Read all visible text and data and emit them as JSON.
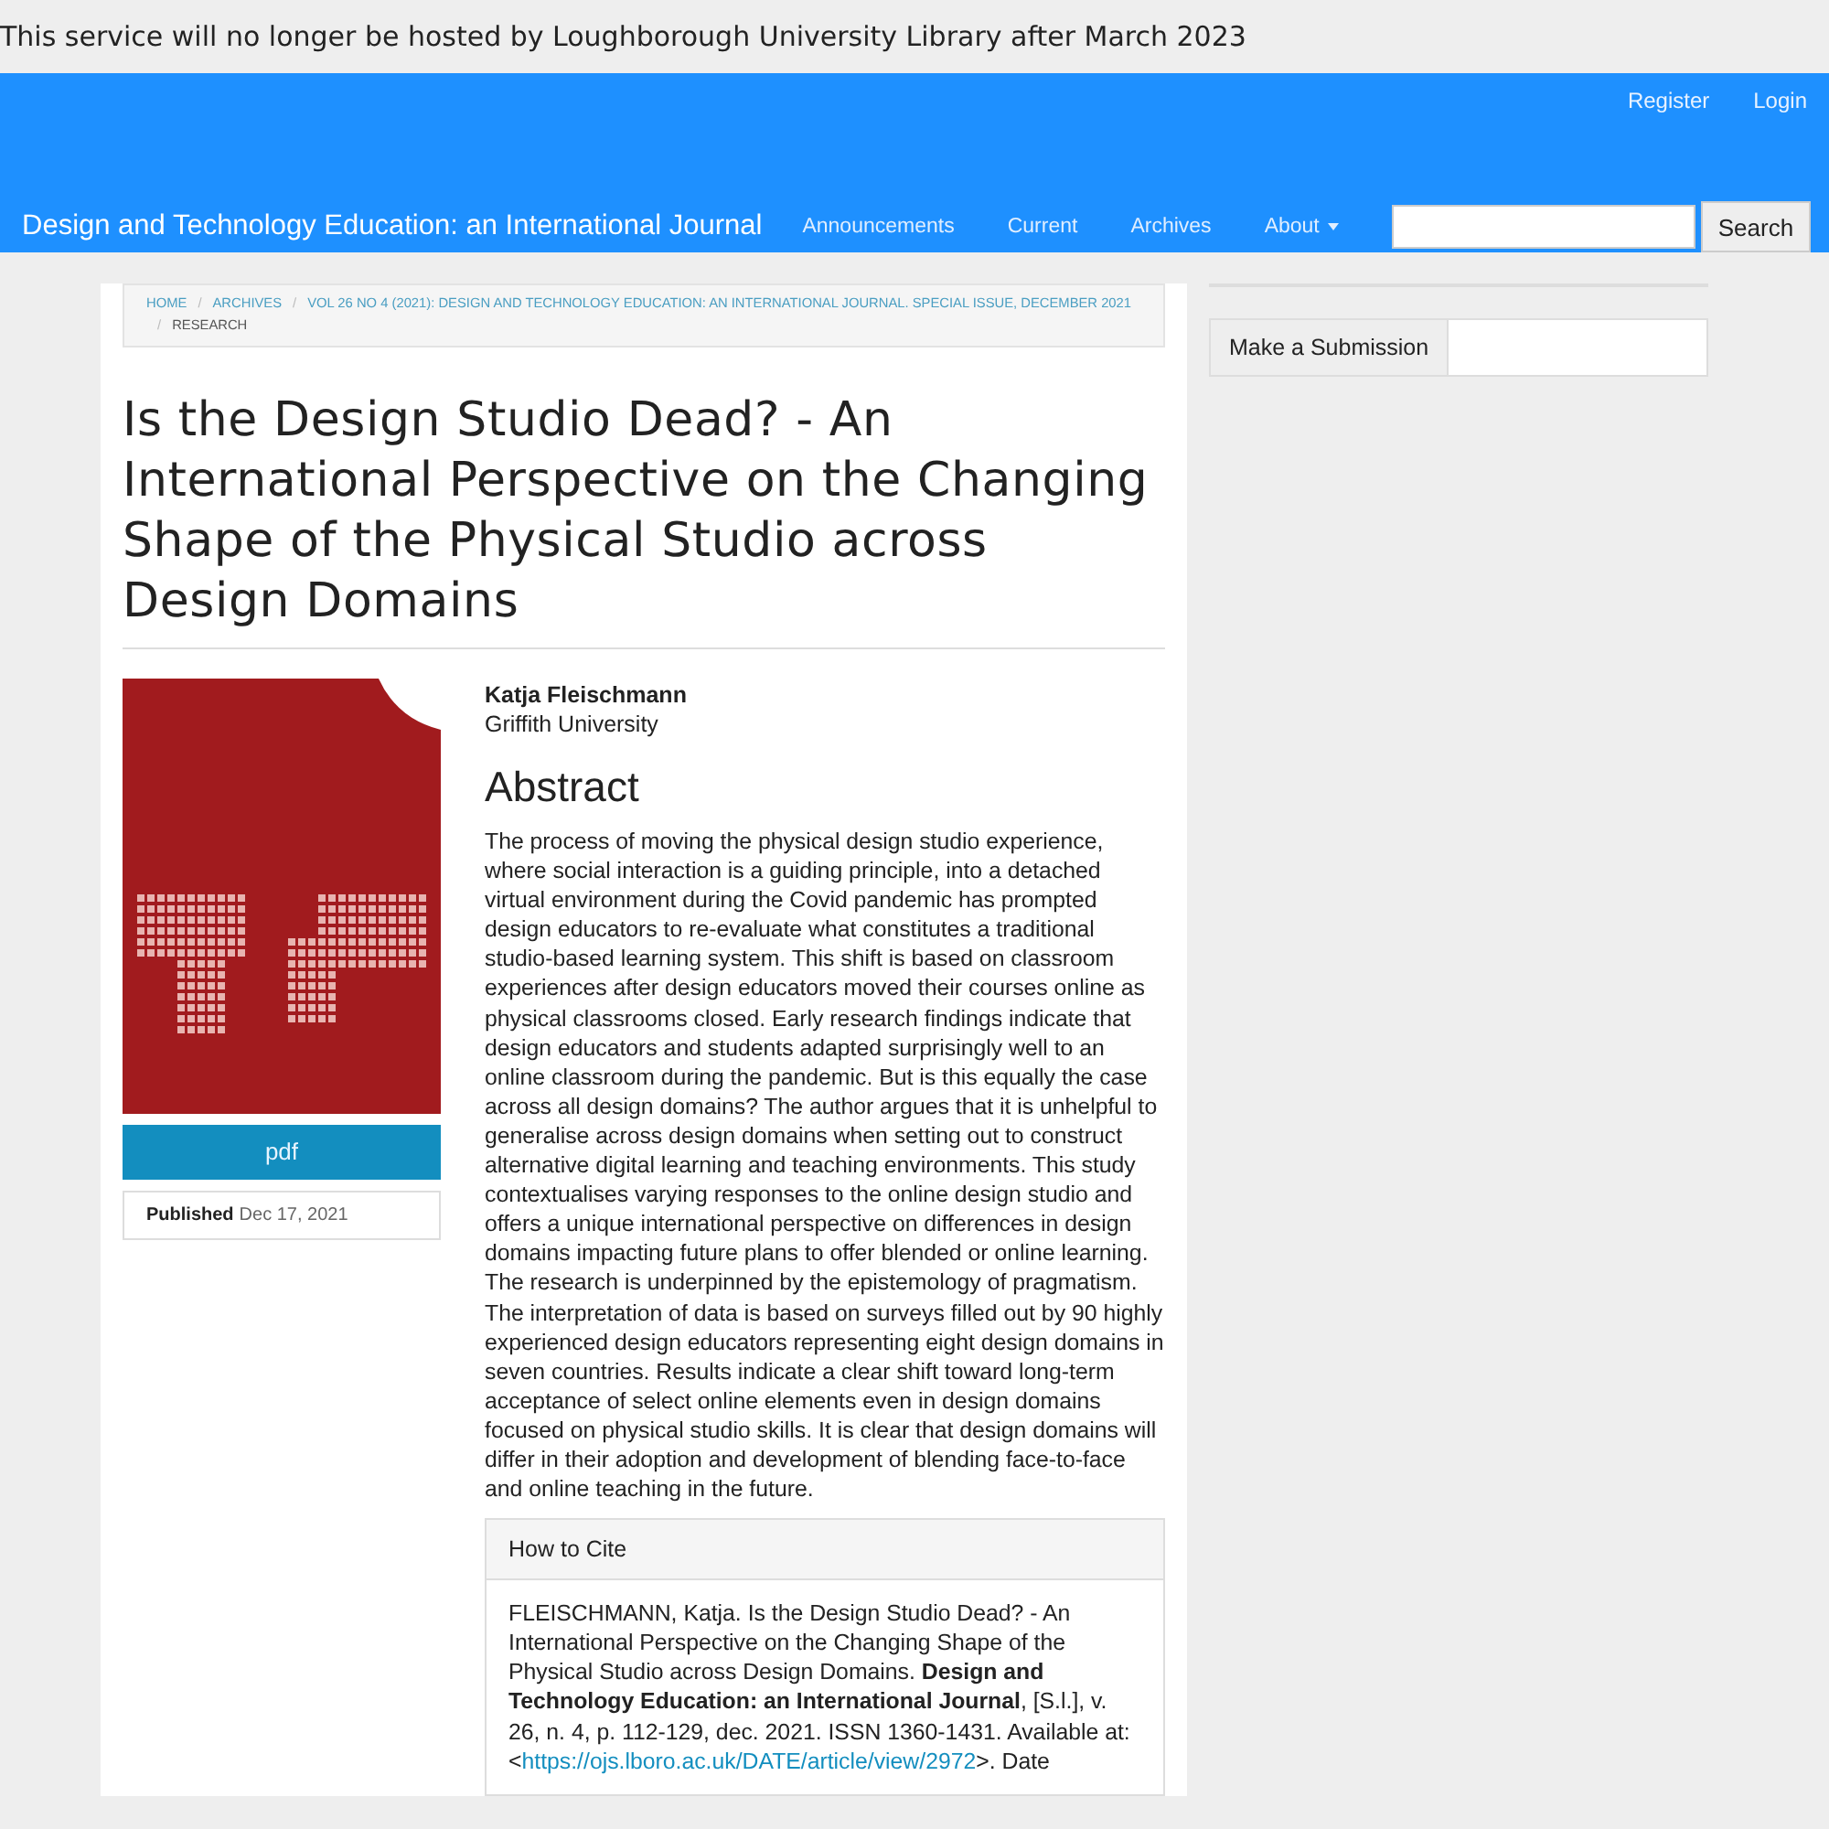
{
  "notice": "This service will no longer be hosted by Loughborough University Library after March 2023",
  "user_nav": [
    "Register",
    "Login"
  ],
  "site_title": "Design and Technology Education: an International Journal",
  "nav": [
    {
      "label": "Announcements",
      "dropdown": false
    },
    {
      "label": "Current",
      "dropdown": false
    },
    {
      "label": "Archives",
      "dropdown": false
    },
    {
      "label": "About",
      "dropdown": true
    }
  ],
  "search": {
    "button": "Search"
  },
  "breadcrumbs": [
    {
      "label": "HOME",
      "link": true
    },
    {
      "separator": "/",
      "label": "ARCHIVES",
      "link": true
    },
    {
      "separator": "/",
      "label": "VOL 26 NO 4 (2021): DESIGN AND TECHNOLOGY EDUCATION: AN INTERNATIONAL JOURNAL. SPECIAL ISSUE, DECEMBER 2021",
      "link": true
    },
    {
      "separator": "/",
      "label": "RESEARCH",
      "link": false
    }
  ],
  "article": {
    "title": "Is the Design Studio Dead? - An International Perspective on the Changing Shape of the Physical Studio across Design Domains",
    "galley": "pdf",
    "published_label": "Published",
    "published_date": "Dec 17, 2021",
    "author": "Katja Fleischmann",
    "affiliation": "Griffith University",
    "abstract_heading": "Abstract",
    "abstract": "The process of moving the physical design studio experience, where social interaction is a guiding principle, into a detached virtual environment during the Covid pandemic has prompted design educators to re-evaluate what constitutes a traditional studio-based learning system. This shift is based on classroom experiences after design educators moved their courses online as physical classrooms closed. Early research findings indicate that design educators and students adapted surprisingly well to an online classroom during the pandemic. But is this equally the case across all design domains? The author argues that it is unhelpful to generalise across design domains when setting out to construct alternative digital learning and teaching environments. This study contextualises varying responses to the online design studio and offers a unique international perspective on differences in design domains impacting future plans to offer blended or online learning. The research is underpinned by the epistemology of pragmatism. The interpretation of data is based on surveys filled out by 90 highly experienced design educators representing eight design domains in seven countries. Results indicate a clear shift toward long-term acceptance of select online elements even in design domains focused on physical studio skills. It is clear that design domains will differ in their adoption and development of blending face-to-face and online teaching in the future.",
    "cite_heading": "How to Cite",
    "citation_before": "FLEISCHMANN, Katja. Is the Design Studio Dead? - An International Perspective on the Changing Shape of the Physical Studio across Design Domains. **Design and Technology Education: an International Journal**, [S.l.], v. 26, n. 4, p. 112-129, dec. 2021. ISSN 1360-1431. Available at: <",
    "citation_link": "https://ojs.lboro.ac.uk/DATE/article/view/2972",
    "citation_after": ">. Date"
  },
  "sidebar": {
    "submission_button": "Make a Submission"
  }
}
